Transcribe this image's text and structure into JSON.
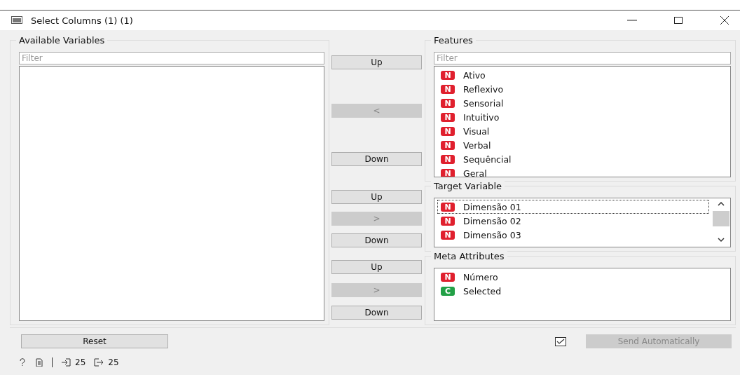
{
  "window": {
    "title": "Select Columns (1) (1)"
  },
  "available": {
    "title": "Available Variables",
    "filter": {
      "placeholder": "Filter"
    }
  },
  "groups": [
    {
      "title": "Features",
      "filter": {
        "placeholder": "Filter"
      },
      "buttons": [
        {
          "label": "Up",
          "disabled": false
        },
        {
          "label": "<",
          "disabled": true
        },
        {
          "label": "Down",
          "disabled": false
        }
      ],
      "scrollbar": false,
      "items": [
        {
          "type": "N",
          "color": "#e0202e",
          "name": "Ativo",
          "focused": false
        },
        {
          "type": "N",
          "color": "#e0202e",
          "name": "Reflexivo",
          "focused": false
        },
        {
          "type": "N",
          "color": "#e0202e",
          "name": "Sensorial",
          "focused": false
        },
        {
          "type": "N",
          "color": "#e0202e",
          "name": "Intuitivo",
          "focused": false
        },
        {
          "type": "N",
          "color": "#e0202e",
          "name": "Visual",
          "focused": false
        },
        {
          "type": "N",
          "color": "#e0202e",
          "name": "Verbal",
          "focused": false
        },
        {
          "type": "N",
          "color": "#e0202e",
          "name": "Sequêncial",
          "focused": false
        },
        {
          "type": "N",
          "color": "#e0202e",
          "name": "Geral",
          "focused": false
        }
      ]
    },
    {
      "title": "Target Variable",
      "buttons": [
        {
          "label": "Up",
          "disabled": false
        },
        {
          "label": ">",
          "disabled": true
        },
        {
          "label": "Down",
          "disabled": false
        }
      ],
      "scrollbar": true,
      "items": [
        {
          "type": "N",
          "color": "#e0202e",
          "name": "Dimensão 01",
          "focused": true
        },
        {
          "type": "N",
          "color": "#e0202e",
          "name": "Dimensão 02",
          "focused": false
        },
        {
          "type": "N",
          "color": "#e0202e",
          "name": "Dimensão 03",
          "focused": false
        }
      ]
    },
    {
      "title": "Meta Attributes",
      "buttons": [
        {
          "label": "Up",
          "disabled": false
        },
        {
          "label": ">",
          "disabled": true
        },
        {
          "label": "Down",
          "disabled": false
        }
      ],
      "scrollbar": false,
      "items": [
        {
          "type": "N",
          "color": "#e0202e",
          "name": "Número",
          "focused": false
        },
        {
          "type": "C",
          "color": "#22a046",
          "name": "Selected",
          "focused": false
        }
      ]
    }
  ],
  "reset": {
    "label": "Reset"
  },
  "auto_send": {
    "checked": true,
    "label": "Send Automatically",
    "disabled": true
  },
  "status": {
    "input_count": "25",
    "output_count": "25"
  }
}
